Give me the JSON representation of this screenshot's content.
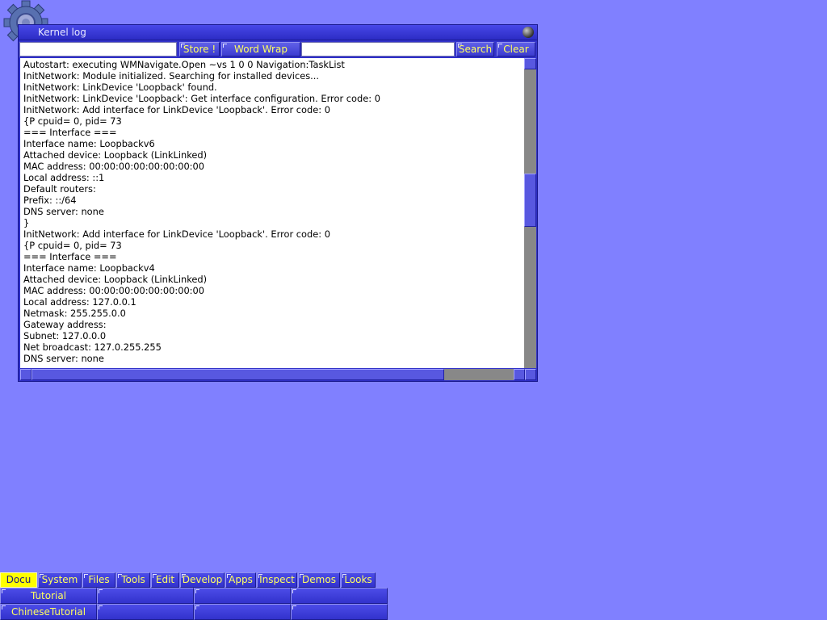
{
  "window": {
    "title": "Kernel log"
  },
  "toolbar": {
    "store_label": "Store !",
    "wordwrap_label": "Word Wrap",
    "search_label": "Search",
    "clear_label": "Clear",
    "left_input_value": "",
    "search_input_value": ""
  },
  "log": {
    "lines": [
      "Autostart: executing WMNavigate.Open ~vs 1 0 0 Navigation:TaskList",
      "InitNetwork: Module initialized. Searching for installed devices...",
      "InitNetwork: LinkDevice 'Loopback' found.",
      "InitNetwork: LinkDevice 'Loopback': Get interface configuration. Error code: 0",
      "InitNetwork: Add interface for LinkDevice 'Loopback'. Error code: 0",
      "{P cpuid= 0, pid= 73",
      "=== Interface ===",
      "Interface name: Loopbackv6",
      "Attached device: Loopback (LinkLinked)",
      "MAC address: 00:00:00:00:00:00:00:00",
      "Local address: ::1",
      "Default routers:",
      "Prefix: ::/64",
      "DNS server: none",
      "}",
      "InitNetwork: Add interface for LinkDevice 'Loopback'. Error code: 0",
      "{P cpuid= 0, pid= 73",
      "=== Interface ===",
      "Interface name: Loopbackv4",
      "Attached device: Loopback (LinkLinked)",
      "MAC address: 00:00:00:00:00:00:00:00",
      "Local address: 127.0.0.1",
      "Netmask: 255.255.0.0",
      "Gateway address:",
      "Subnet: 127.0.0.0",
      "Net broadcast: 127.0.255.255",
      "DNS server: none"
    ]
  },
  "taskbar": {
    "tabs": [
      {
        "label": "Docu"
      },
      {
        "label": "System"
      },
      {
        "label": "Files"
      },
      {
        "label": "Tools"
      },
      {
        "label": "Edit"
      },
      {
        "label": "Develop"
      },
      {
        "label": "Apps"
      },
      {
        "label": "Inspect"
      },
      {
        "label": "Demos"
      },
      {
        "label": "Looks"
      }
    ],
    "active_tab": "Docu",
    "items": [
      {
        "label": "Tutorial"
      },
      {
        "label": ""
      },
      {
        "label": ""
      },
      {
        "label": ""
      },
      {
        "label": "ChineseTutorial"
      },
      {
        "label": ""
      },
      {
        "label": ""
      },
      {
        "label": ""
      }
    ]
  },
  "colors": {
    "desktop": "#8080ff",
    "window_frame": "#3030c8",
    "button_text": "#ffff60",
    "active_tab": "#ffff00"
  },
  "icons": {
    "system_icon": "gear-icon",
    "window_close": "close-ball-icon"
  }
}
